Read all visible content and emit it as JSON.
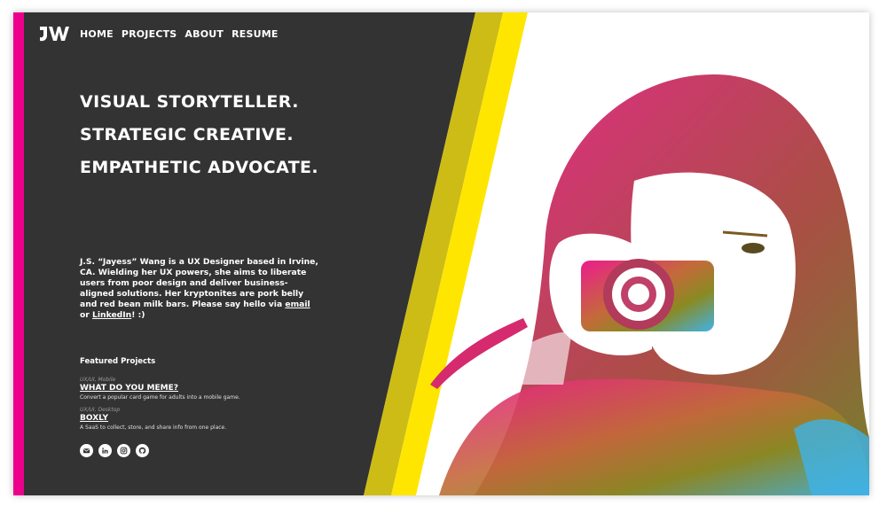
{
  "nav": {
    "logo_text": "JW",
    "links": [
      "HOME",
      "PROJECTS",
      "ABOUT",
      "RESUME"
    ]
  },
  "hero": {
    "lines": [
      "VISUAL STORYTELLER.",
      "STRATEGIC CREATIVE.",
      "EMPATHETIC ADVOCATE."
    ]
  },
  "bio": {
    "text": "J.S. “Jayess” Wang is a UX Designer based in Irvine, CA. Wielding her UX powers, she aims to liberate users from poor design and deliver business-aligned solutions. Her kryptonites are pork belly and red bean milk bars. Please say hello via ",
    "email_label": "email",
    "or": " or ",
    "linkedin_label": "LinkedIn",
    "ending": "! :)"
  },
  "featured": {
    "title": "Featured Projects",
    "projects": [
      {
        "category": "UX/UI, Mobile",
        "name": "WHAT DO YOU MEME?",
        "desc": "Convert a popular card game for adults into a mobile game."
      },
      {
        "category": "UX/UI, Desktop",
        "name": "BOXLY",
        "desc": "A SaaS to collect, store, and share info from one place."
      }
    ]
  },
  "socials": [
    "email-icon",
    "linkedin-icon",
    "instagram-icon",
    "github-icon"
  ],
  "colors": {
    "panel": "#333333",
    "accent_pink": "#ec008c",
    "stripe_olive": "#cdbc15",
    "stripe_yellow": "#ffe600"
  }
}
